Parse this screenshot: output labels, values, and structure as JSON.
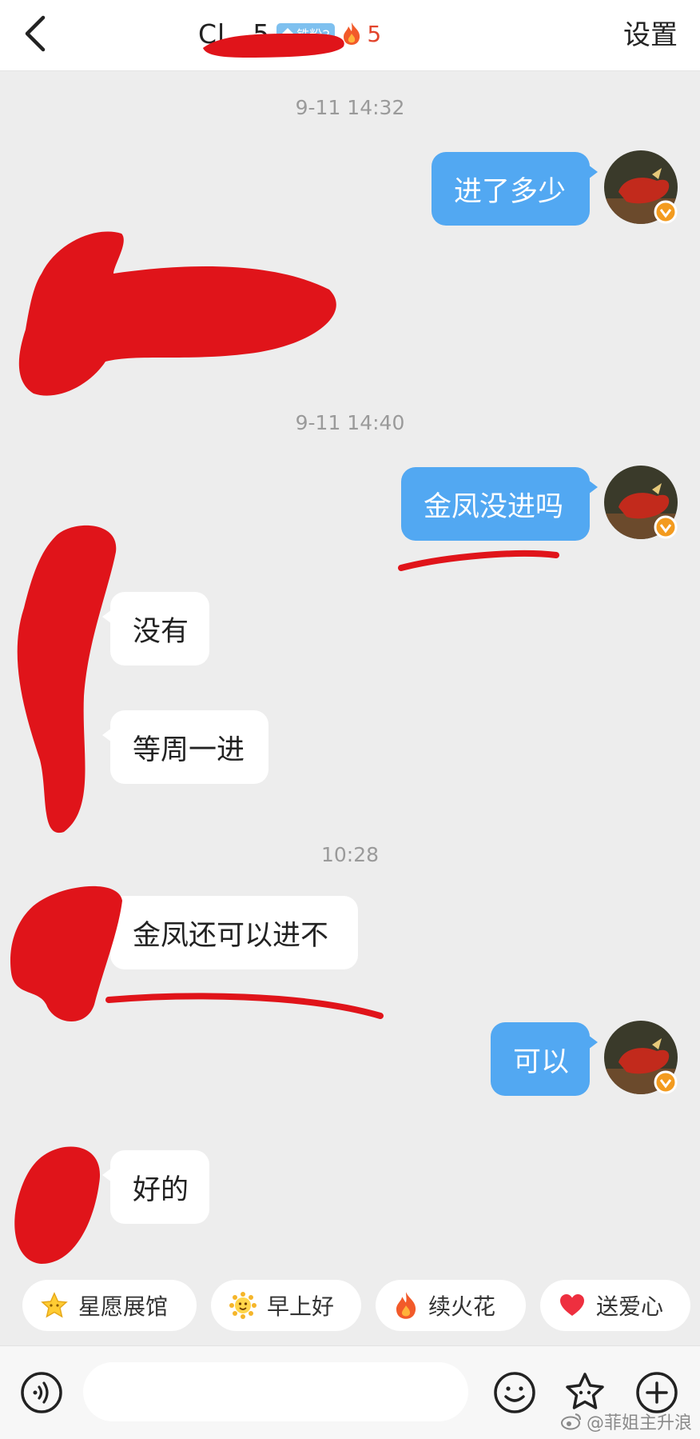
{
  "header": {
    "title": "Cl…5",
    "fan_badge": "铁粉2",
    "fire_count": "5",
    "settings_label": "设置"
  },
  "messages": [
    {
      "time": "9-11 14:32"
    },
    {
      "text": "进了多少"
    },
    {
      "time": "9-11 14:40"
    },
    {
      "text": "金凤没进吗"
    },
    {
      "text": "没有"
    },
    {
      "text": "等周一进"
    },
    {
      "time": "10:28"
    },
    {
      "text": "金凤还可以进不"
    },
    {
      "text": "可以"
    },
    {
      "text": "好的"
    }
  ],
  "quick_replies": [
    {
      "label": "星愿展馆",
      "icon": "star-icon"
    },
    {
      "label": "早上好",
      "icon": "sun-face-icon"
    },
    {
      "label": "续火花",
      "icon": "flame-icon"
    },
    {
      "label": "送爱心",
      "icon": "heart-icon"
    }
  ],
  "input_bar": {
    "placeholder": ""
  },
  "watermark": "@菲姐主升浪",
  "colors": {
    "outgoing_bubble": "#52a8f2",
    "incoming_bubble": "#ffffff",
    "background": "#ededed",
    "redaction": "#e0141a",
    "fire": "#e2442c"
  }
}
